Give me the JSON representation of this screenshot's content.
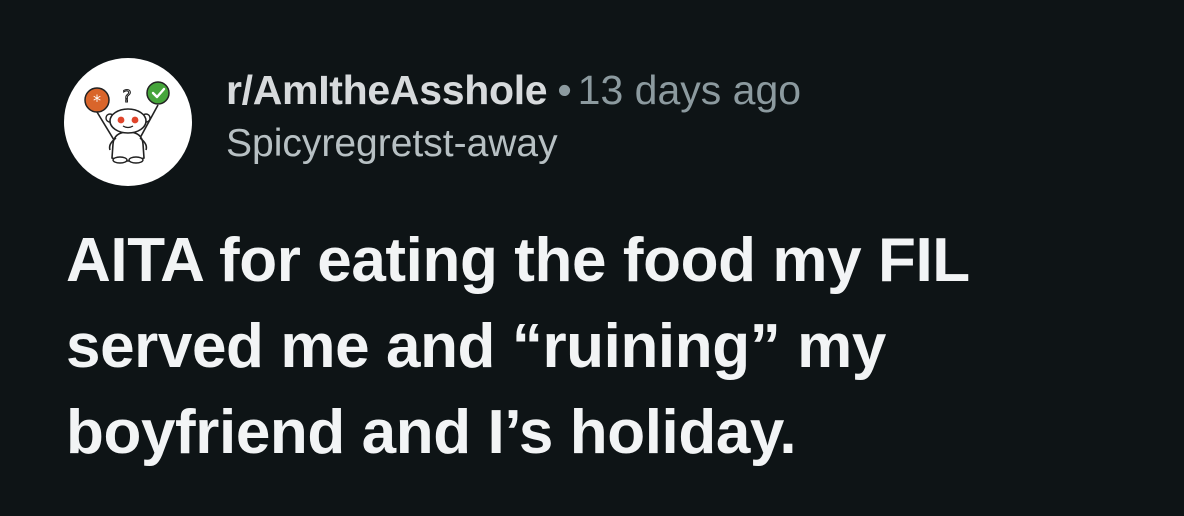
{
  "post": {
    "subreddit": "r/AmItheAsshole",
    "separator": "•",
    "time_ago": "13 days ago",
    "author": "Spicyregretst-away",
    "title": "AITA for eating the food my FIL served me and “ruining” my boyfriend and I’s holiday.",
    "avatar_icon": "reddit-snoo-balloons-icon"
  },
  "colors": {
    "background": "#0e1416",
    "title_text": "#f2f4f5",
    "subreddit_text": "#d7dadc",
    "meta_text": "#8c9a9f",
    "balloon_orange": "#d9652b",
    "balloon_green": "#46a53b"
  }
}
